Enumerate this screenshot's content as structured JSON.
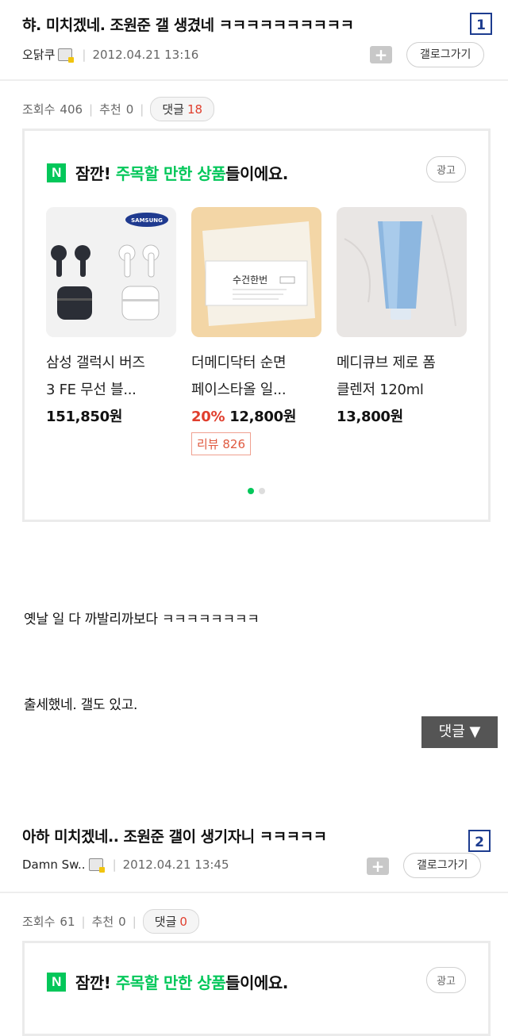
{
  "post1": {
    "title": "햐. 미치겠네. 조원준 갤 생겼네 ㅋㅋㅋㅋㅋㅋㅋㅋㅋㅋ",
    "number": "1",
    "author": "오닭쿠",
    "date": "2012.04.21 13:16",
    "plus": "+",
    "gallery_button": "갤로그가기",
    "views_label": "조회수",
    "views": "406",
    "likes_label": "추천",
    "likes": "0",
    "comments_label": "댓글",
    "comments": "18",
    "ad": {
      "logo": "N",
      "head_prefix": "잠깐! ",
      "head_highlight": "주목할 만한 상품",
      "head_suffix": "들이에요.",
      "tag": "광고",
      "products": [
        {
          "line1": "삼성 갤럭시 버즈",
          "line2": "3 FE 무선 블...",
          "price": "151,850원"
        },
        {
          "line1": "더메디닥터 순면",
          "line2": "페이스타올 일...",
          "discount": "20%",
          "price": "12,800원",
          "review": "리뷰 826"
        },
        {
          "line1": "메디큐브 제로 폼",
          "line2": "클렌저 120ml",
          "price": "13,800원"
        }
      ],
      "brand_samsung": "SAMSUNG",
      "towel_label": "수건한번"
    },
    "body": [
      "옛날 일 다 까발리까보다 ㅋㅋㅋㅋㅋㅋㅋㅋ",
      "출세했네. 갤도 있고."
    ],
    "comment_button": "댓글 ▼"
  },
  "post2": {
    "title": "아하 미치겠네.. 조원준 갤이 생기자니 ㅋㅋㅋㅋㅋ",
    "number": "2",
    "author": "Damn Sw..",
    "date": "2012.04.21 13:45",
    "plus": "+",
    "gallery_button": "갤로그가기",
    "views_label": "조회수",
    "views": "61",
    "likes_label": "추천",
    "likes": "0",
    "comments_label": "댓글",
    "comments": "0",
    "ad": {
      "logo": "N",
      "head_prefix": "잠깐! ",
      "head_highlight": "주목할 만한 상품",
      "head_suffix": "들이에요.",
      "tag": "광고"
    }
  },
  "colors": {
    "accent_green": "#03c75a",
    "count_red": "#e03e2d",
    "number_blue": "#1d3c8f"
  }
}
